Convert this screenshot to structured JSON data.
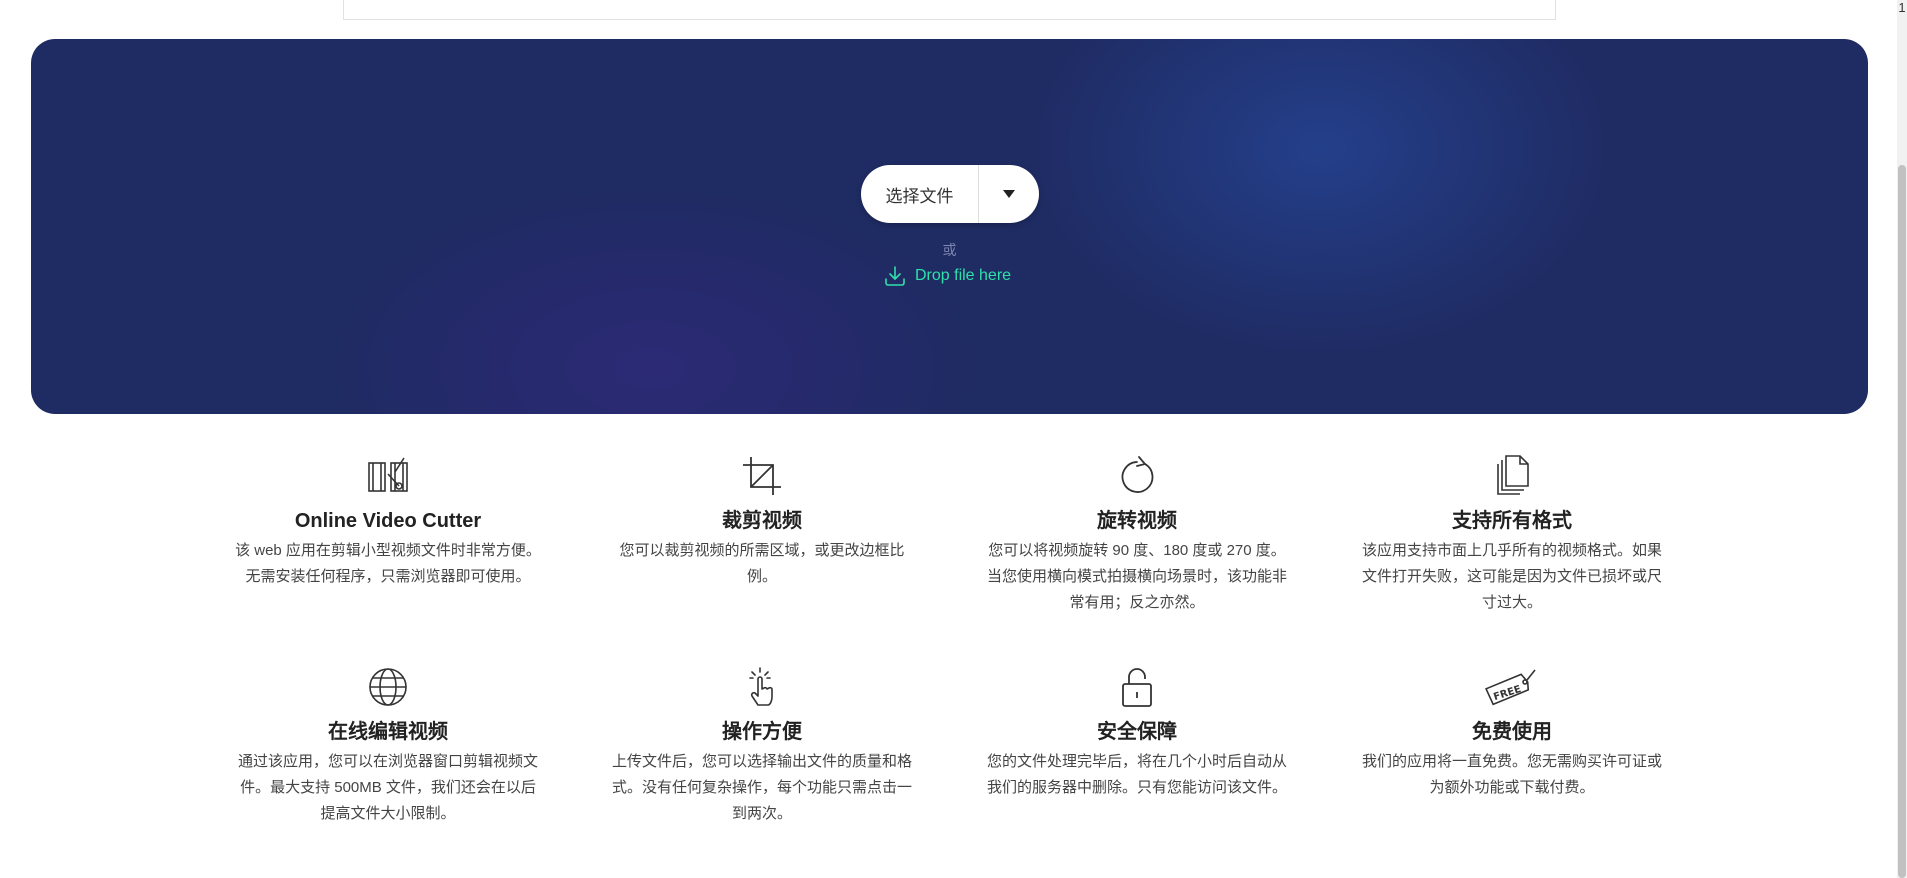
{
  "corner_glyph": "1",
  "upload": {
    "choose_label": "选择文件",
    "or_label": "或",
    "drop_label": "Drop file here"
  },
  "colors": {
    "hero_bg": "#1f2b63",
    "drop_accent": "#2fe0a9"
  },
  "features": [
    {
      "icon": "film-cut-icon",
      "title": "Online Video Cutter",
      "desc": "该 web 应用在剪辑小型视频文件时非常方便。无需安装任何程序，只需浏览器即可使用。"
    },
    {
      "icon": "crop-icon",
      "title": "裁剪视频",
      "desc": "您可以裁剪视频的所需区域，或更改边框比例。"
    },
    {
      "icon": "rotate-icon",
      "title": "旋转视频",
      "desc": "您可以将视频旋转 90 度、180 度或 270 度。当您使用横向模式拍摄横向场景时，该功能非常有用；反之亦然。"
    },
    {
      "icon": "documents-icon",
      "title": "支持所有格式",
      "desc": "该应用支持市面上几乎所有的视频格式。如果文件打开失败，这可能是因为文件已损坏或尺寸过大。"
    },
    {
      "icon": "globe-icon",
      "title": "在线编辑视频",
      "desc": "通过该应用，您可以在浏览器窗口剪辑视频文件。最大支持 500MB 文件，我们还会在以后提高文件大小限制。"
    },
    {
      "icon": "pointer-hand-icon",
      "title": "操作方便",
      "desc": "上传文件后，您可以选择输出文件的质量和格式。没有任何复杂操作，每个功能只需点击一到两次。"
    },
    {
      "icon": "padlock-icon",
      "title": "安全保障",
      "desc": "您的文件处理完毕后，将在几个小时后自动从我们的服务器中删除。只有您能访问该文件。"
    },
    {
      "icon": "free-tag-icon",
      "title": "免费使用",
      "desc": "我们的应用将一直免费。您无需购买许可证或为额外功能或下载付费。"
    }
  ]
}
